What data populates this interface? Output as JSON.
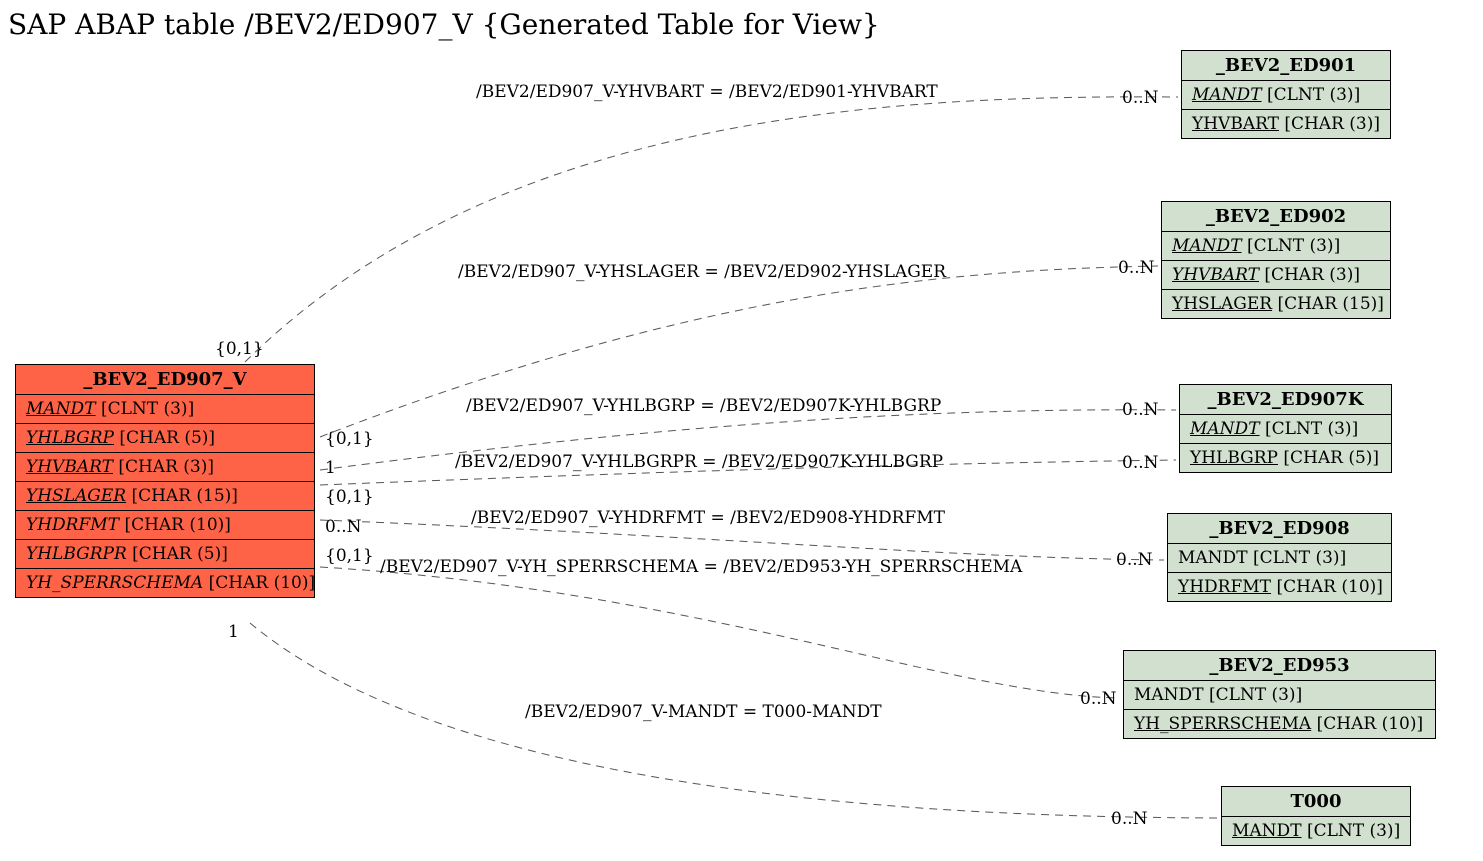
{
  "title": "SAP ABAP table /BEV2/ED907_V {Generated Table for View}",
  "main": {
    "name": "_BEV2_ED907_V",
    "rows": [
      {
        "field": "MANDT",
        "type": "[CLNT (3)]",
        "ud": true,
        "it": true
      },
      {
        "field": "YHLBGRP",
        "type": "[CHAR (5)]",
        "ud": true,
        "it": true
      },
      {
        "field": "YHVBART",
        "type": "[CHAR (3)]",
        "ud": true,
        "it": true
      },
      {
        "field": "YHSLAGER",
        "type": "[CHAR (15)]",
        "ud": true,
        "it": true
      },
      {
        "field": "YHDRFMT",
        "type": "[CHAR (10)]",
        "ud": false,
        "it": true
      },
      {
        "field": "YHLBGRPR",
        "type": "[CHAR (5)]",
        "ud": false,
        "it": true
      },
      {
        "field": "YH_SPERRSCHEMA",
        "type": "[CHAR (10)]",
        "ud": false,
        "it": true
      }
    ]
  },
  "targets": [
    {
      "name": "_BEV2_ED901",
      "rows": [
        {
          "field": "MANDT",
          "type": "[CLNT (3)]",
          "ud": true,
          "it": true
        },
        {
          "field": "YHVBART",
          "type": "[CHAR (3)]",
          "ud": true,
          "it": false
        }
      ]
    },
    {
      "name": "_BEV2_ED902",
      "rows": [
        {
          "field": "MANDT",
          "type": "[CLNT (3)]",
          "ud": true,
          "it": true
        },
        {
          "field": "YHVBART",
          "type": "[CHAR (3)]",
          "ud": true,
          "it": true
        },
        {
          "field": "YHSLAGER",
          "type": "[CHAR (15)]",
          "ud": true,
          "it": false
        }
      ]
    },
    {
      "name": "_BEV2_ED907K",
      "rows": [
        {
          "field": "MANDT",
          "type": "[CLNT (3)]",
          "ud": true,
          "it": true
        },
        {
          "field": "YHLBGRP",
          "type": "[CHAR (5)]",
          "ud": true,
          "it": false
        }
      ]
    },
    {
      "name": "_BEV2_ED908",
      "rows": [
        {
          "field": "MANDT",
          "type": "[CLNT (3)]",
          "ud": false,
          "it": false
        },
        {
          "field": "YHDRFMT",
          "type": "[CHAR (10)]",
          "ud": true,
          "it": false
        }
      ]
    },
    {
      "name": "_BEV2_ED953",
      "rows": [
        {
          "field": "MANDT",
          "type": "[CLNT (3)]",
          "ud": false,
          "it": false
        },
        {
          "field": "YH_SPERRSCHEMA",
          "type": "[CHAR (10)]",
          "ud": true,
          "it": false
        }
      ]
    },
    {
      "name": "T000",
      "rows": [
        {
          "field": "MANDT",
          "type": "[CLNT (3)]",
          "ud": true,
          "it": false
        }
      ]
    }
  ],
  "edges": [
    "/BEV2/ED907_V-YHVBART = /BEV2/ED901-YHVBART",
    "/BEV2/ED907_V-YHSLAGER = /BEV2/ED902-YHSLAGER",
    "/BEV2/ED907_V-YHLBGRP = /BEV2/ED907K-YHLBGRP",
    "/BEV2/ED907_V-YHLBGRPR = /BEV2/ED907K-YHLBGRP",
    "/BEV2/ED907_V-YHDRFMT = /BEV2/ED908-YHDRFMT",
    "/BEV2/ED907_V-YH_SPERRSCHEMA = /BEV2/ED953-YH_SPERRSCHEMA",
    "/BEV2/ED907_V-MANDT = T000-MANDT"
  ],
  "source_card": [
    "{0,1}",
    "{0,1}",
    "1",
    "{0,1}",
    "0..N",
    "{0,1}",
    "1"
  ],
  "target_card": [
    "0..N",
    "0..N",
    "0..N",
    "0..N",
    "0..N",
    "0..N",
    "0..N"
  ]
}
